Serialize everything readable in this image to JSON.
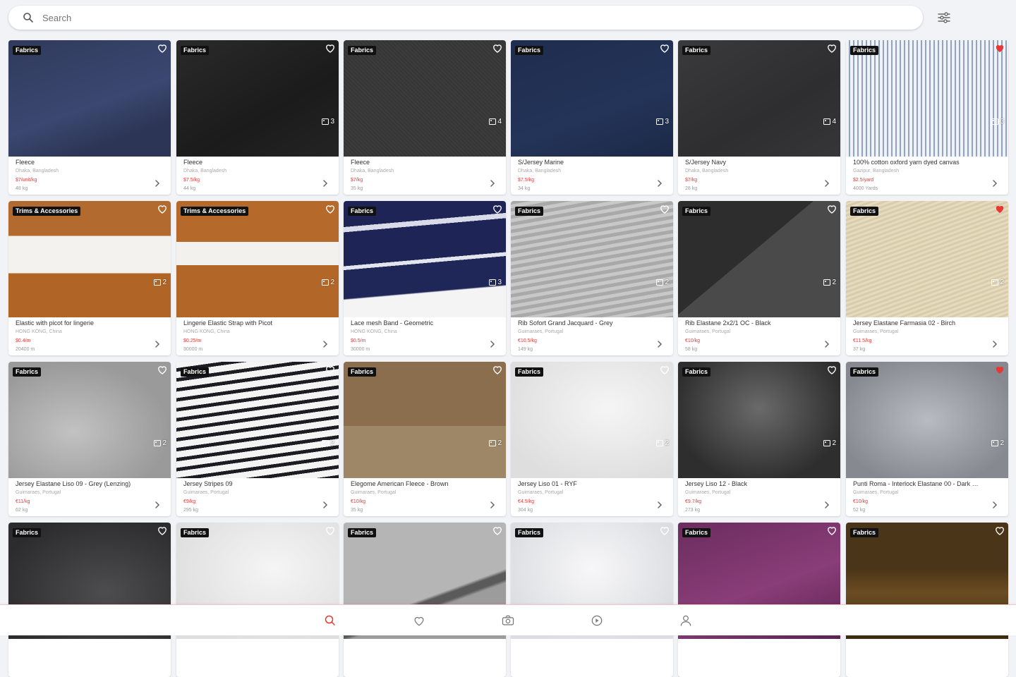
{
  "search": {
    "placeholder": "Search"
  },
  "icons": {
    "search": "search-icon",
    "filter": "sliders-icon",
    "heart": "heart-icon",
    "photos": "photos-icon",
    "chevron": "chevron-right-icon"
  },
  "colors": {
    "accent": "#e53935",
    "favorite": "#e53935",
    "badge": "#111111"
  },
  "products": [
    {
      "category": "Fabrics",
      "title": "Fleece",
      "location": "Dhaka, Bangladesh",
      "price": "$7/unit/kg",
      "quantity": "48 kg",
      "photos": "",
      "favorite": false,
      "swatch": "navy-fleece"
    },
    {
      "category": "Fabrics",
      "title": "Fleece",
      "location": "Dhaka, Bangladesh",
      "price": "$7.5/kg",
      "quantity": "44 kg",
      "photos": "3",
      "favorite": false,
      "swatch": "black"
    },
    {
      "category": "Fabrics",
      "title": "Fleece",
      "location": "Dhaka, Bangladesh",
      "price": "$7/kg",
      "quantity": "35 kg",
      "photos": "4",
      "favorite": false,
      "swatch": "charcoal"
    },
    {
      "category": "Fabrics",
      "title": "S/Jersey Marine",
      "location": "Dhaka, Bangladesh",
      "price": "$7.5/kg",
      "quantity": "34 kg",
      "photos": "3",
      "favorite": false,
      "swatch": "marine"
    },
    {
      "category": "Fabrics",
      "title": "S/Jersey Navy",
      "location": "Dhaka, Bangladesh",
      "price": "$7/kg",
      "quantity": "28 kg",
      "photos": "4",
      "favorite": false,
      "swatch": "dark-grey"
    },
    {
      "category": "Fabrics",
      "title": "100% cotton oxford yarn dyed canvas",
      "location": "Gazipur, Bangladesh",
      "price": "$2.5/yard",
      "quantity": "4000 Yards",
      "photos": "3",
      "favorite": true,
      "swatch": "stripe-blue"
    },
    {
      "category": "Trims & Accessories",
      "title": "Elastic with picot for lingerie",
      "location": "HONG KONG, China",
      "price": "$0.4/m",
      "quantity": "20400 m",
      "photos": "2",
      "favorite": false,
      "swatch": "elastic"
    },
    {
      "category": "Trims & Accessories",
      "title": "Lingerie Elastic Strap with Picot",
      "location": "HONG KONG, China",
      "price": "$0.25/m",
      "quantity": "30000 m",
      "photos": "2",
      "favorite": false,
      "swatch": "elastic2"
    },
    {
      "category": "Fabrics",
      "title": "Lace mesh Band - Geometric",
      "location": "HONG KONG, China",
      "price": "$0.5/m",
      "quantity": "30000 m",
      "photos": "3",
      "favorite": false,
      "swatch": "band"
    },
    {
      "category": "Fabrics",
      "title": "Rib Sofort Grand Jacquard - Grey",
      "location": "Guimaraes, Portugal",
      "price": "€10.5/kg",
      "quantity": "149 kg",
      "photos": "2",
      "favorite": false,
      "swatch": "rib-grey"
    },
    {
      "category": "Fabrics",
      "title": "Rib Elastane 2x2/1 OC - Black",
      "location": "Guimaraes, Portugal",
      "price": "€10/kg",
      "quantity": "58 kg",
      "photos": "2",
      "favorite": false,
      "swatch": "rib-black"
    },
    {
      "category": "Fabrics",
      "title": "Jersey Elastane Farmasia 02 - Birch",
      "location": "Guimaraes, Portugal",
      "price": "€11.5/kg",
      "quantity": "37 kg",
      "photos": "2",
      "favorite": true,
      "swatch": "birch"
    },
    {
      "category": "Fabrics",
      "title": "Jersey Elastane Liso 09 - Grey (Lenzing)",
      "location": "Guimaraes, Portugal",
      "price": "€11/kg",
      "quantity": "62 kg",
      "photos": "2",
      "favorite": false,
      "swatch": "silk-grey"
    },
    {
      "category": "Fabrics",
      "title": "Jersey Stripes 09",
      "location": "Guimaraes, Portugal",
      "price": "€9/kg",
      "quantity": "295 kg",
      "photos": "2",
      "favorite": false,
      "swatch": "stripes"
    },
    {
      "category": "Fabrics",
      "title": "Elegome American Fleece - Brown",
      "location": "Guimaraes, Portugal",
      "price": "€10/kg",
      "quantity": "35 kg",
      "photos": "2",
      "favorite": false,
      "swatch": "brown"
    },
    {
      "category": "Fabrics",
      "title": "Jersey Liso 01 - RYF",
      "location": "Guimaraes, Portugal",
      "price": "€4.5/kg",
      "quantity": "304 kg",
      "photos": "2",
      "favorite": false,
      "swatch": "white-rib"
    },
    {
      "category": "Fabrics",
      "title": "Jersey Liso 12 - Black",
      "location": "Guimaraes, Portugal",
      "price": "€9.7/kg",
      "quantity": "273 kg",
      "photos": "2",
      "favorite": false,
      "swatch": "satin-dark"
    },
    {
      "category": "Fabrics",
      "title": "Punti Roma - Interlock Elastane 00 - Dark …",
      "location": "Guimaraes, Portugal",
      "price": "€10/kg",
      "quantity": "52 kg",
      "photos": "2",
      "favorite": true,
      "swatch": "drape-grey"
    },
    {
      "category": "Fabrics",
      "title": "",
      "location": "",
      "price": "",
      "quantity": "",
      "photos": "",
      "favorite": false,
      "swatch": "dark-drape"
    },
    {
      "category": "Fabrics",
      "title": "",
      "location": "",
      "price": "",
      "quantity": "",
      "photos": "",
      "favorite": false,
      "swatch": "white-rib"
    },
    {
      "category": "Fabrics",
      "title": "",
      "location": "",
      "price": "",
      "quantity": "",
      "photos": "",
      "favorite": false,
      "swatch": "grey-fleece"
    },
    {
      "category": "Fabrics",
      "title": "",
      "location": "",
      "price": "",
      "quantity": "",
      "photos": "",
      "favorite": false,
      "swatch": "white-drape"
    },
    {
      "category": "Fabrics",
      "title": "",
      "location": "",
      "price": "",
      "quantity": "",
      "photos": "",
      "favorite": false,
      "swatch": "purple"
    },
    {
      "category": "Fabrics",
      "title": "",
      "location": "",
      "price": "",
      "quantity": "",
      "photos": "",
      "favorite": false,
      "swatch": "bronze"
    }
  ],
  "bottom_nav": [
    {
      "name": "nav-search",
      "icon": "search-icon",
      "active": true
    },
    {
      "name": "nav-favorites",
      "icon": "heart-icon",
      "active": false
    },
    {
      "name": "nav-camera",
      "icon": "camera-icon",
      "active": false
    },
    {
      "name": "nav-video",
      "icon": "play-icon",
      "active": false
    },
    {
      "name": "nav-profile",
      "icon": "user-icon",
      "active": false
    }
  ]
}
